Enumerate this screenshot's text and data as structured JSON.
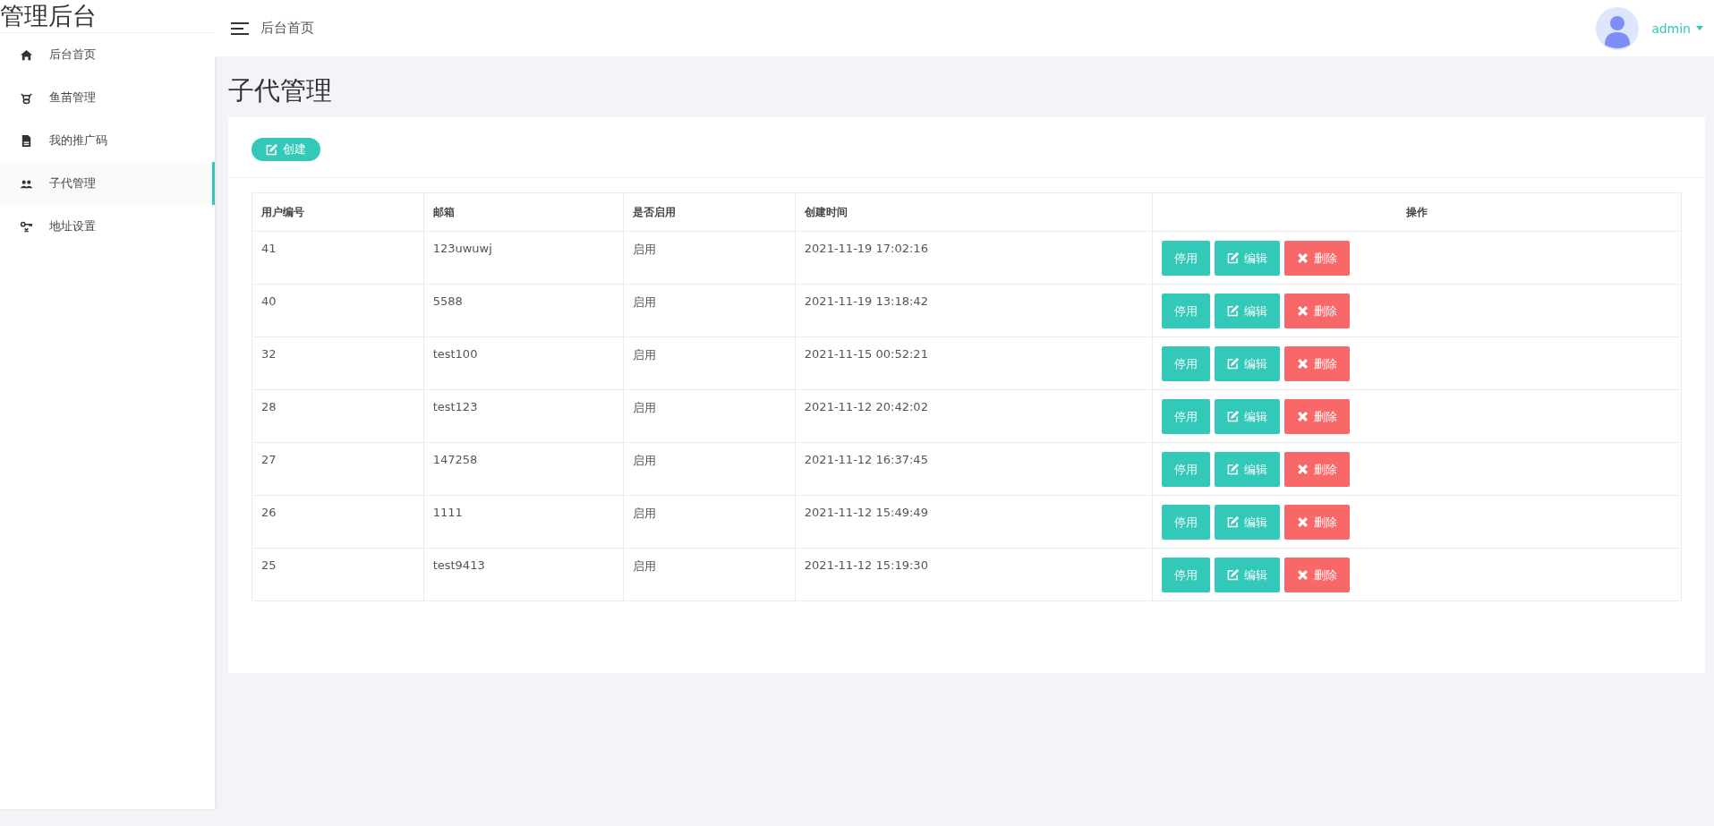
{
  "brand": "管理后台",
  "sidebar": {
    "items": [
      {
        "label": "后台首页",
        "selected": false
      },
      {
        "label": "鱼苗管理",
        "selected": false
      },
      {
        "label": "我的推广码",
        "selected": false
      },
      {
        "label": "子代管理",
        "selected": true
      },
      {
        "label": "地址设置",
        "selected": false
      }
    ]
  },
  "header": {
    "breadcrumb": "后台首页",
    "user": "admin"
  },
  "page_title": "子代管理",
  "create_button": "创建",
  "table": {
    "columns": [
      "用户编号",
      "邮箱",
      "是否启用",
      "创建时间",
      "操作"
    ],
    "rows": [
      {
        "id": "41",
        "email": "123uwuwj",
        "enabled": "启用",
        "created": "2021-11-19 17:02:16",
        "actions": [
          "停用",
          "编辑",
          "删除"
        ]
      },
      {
        "id": "40",
        "email": "5588",
        "enabled": "启用",
        "created": "2021-11-19 13:18:42",
        "actions": [
          "停用",
          "编辑",
          "删除"
        ]
      },
      {
        "id": "32",
        "email": "test100",
        "enabled": "启用",
        "created": "2021-11-15 00:52:21",
        "actions": [
          "停用",
          "编辑",
          "删除"
        ]
      },
      {
        "id": "28",
        "email": "test123",
        "enabled": "启用",
        "created": "2021-11-12 20:42:02",
        "actions": [
          "停用",
          "编辑",
          "删除"
        ]
      },
      {
        "id": "27",
        "email": "147258",
        "enabled": "启用",
        "created": "2021-11-12 16:37:45",
        "actions": [
          "停用",
          "编辑",
          "删除"
        ]
      },
      {
        "id": "26",
        "email": "1111",
        "enabled": "启用",
        "created": "2021-11-12 15:49:49",
        "actions": [
          "停用",
          "编辑",
          "删除"
        ]
      },
      {
        "id": "25",
        "email": "test9413",
        "enabled": "启用",
        "created": "2021-11-12 15:19:30",
        "actions": [
          "停用",
          "编辑",
          "删除"
        ]
      }
    ]
  }
}
